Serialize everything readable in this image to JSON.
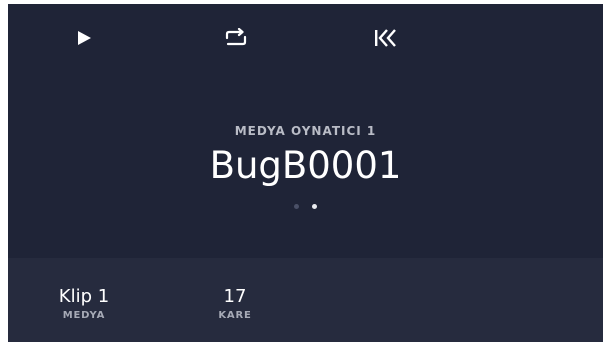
{
  "controls": {
    "play_icon": "play-icon",
    "loop_icon": "loop-icon",
    "skip_to_start_icon": "skip-to-start-icon"
  },
  "player": {
    "source_label": "MEDYA OYNATICI 1",
    "clip_name": "BugB0001",
    "page_count": 2,
    "active_page": 2
  },
  "footer": {
    "clip": {
      "value": "Klip 1",
      "label": "MEDYA"
    },
    "frame": {
      "value": "17",
      "label": "KARE"
    }
  },
  "colors": {
    "background": "#1f2437",
    "footer_background": "#262b3e",
    "text": "#ffffff",
    "muted_text": "#b9bcc6"
  }
}
